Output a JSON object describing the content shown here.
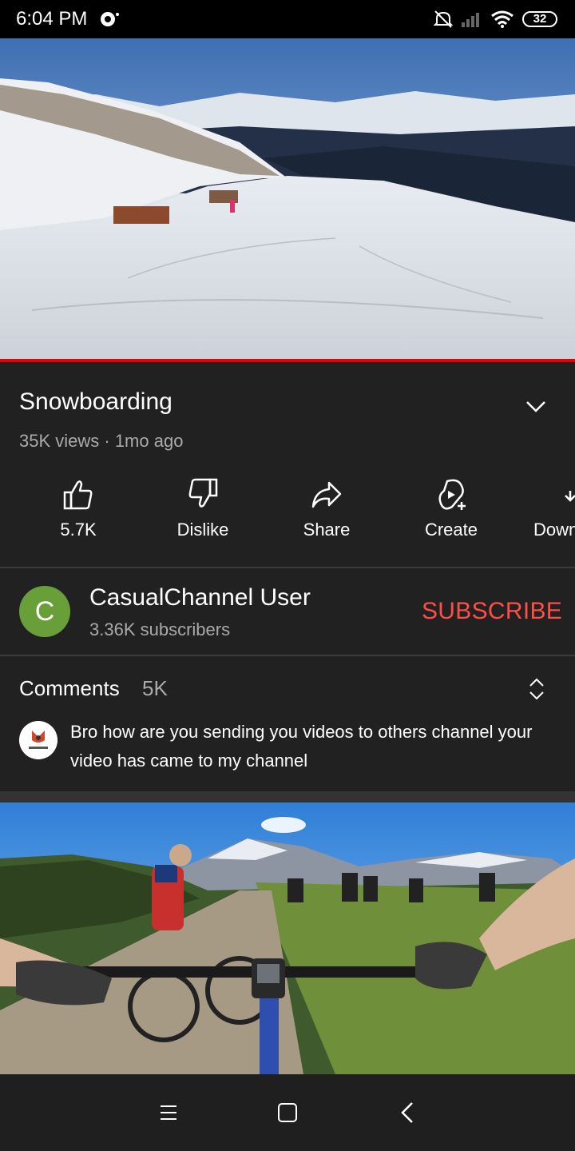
{
  "status": {
    "time": "6:04 PM",
    "battery": "32"
  },
  "video": {
    "title": "Snowboarding",
    "meta": "35K views · 1mo ago",
    "progress_fraction": 1.0
  },
  "actions": {
    "like": "5.7K",
    "dislike": "Dislike",
    "share": "Share",
    "create": "Create",
    "download": "Down"
  },
  "channel": {
    "avatar_letter": "C",
    "name": "CasualChannel User",
    "subscribers": "3.36K subscribers",
    "subscribe_label": "SUBSCRIBE",
    "avatar_color": "#689f38"
  },
  "comments": {
    "label": "Comments",
    "count": "5K",
    "top_comment": "Bro how are you sending you videos to others channel your video has came to my channel"
  },
  "colors": {
    "accent": "#ff4e45",
    "progress": "#ee0000",
    "background": "#212121"
  }
}
